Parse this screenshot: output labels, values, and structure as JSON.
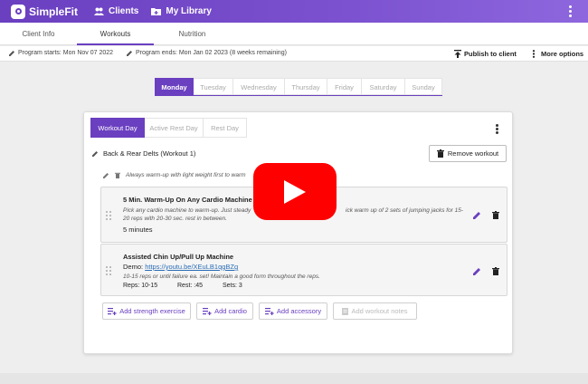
{
  "app": {
    "name": "SimpleFit"
  },
  "topnav": {
    "clients": "Clients",
    "library": "My Library"
  },
  "tabs": [
    {
      "label": "Client Info"
    },
    {
      "label": "Workouts"
    },
    {
      "label": "Nutrition"
    }
  ],
  "infobar": {
    "program_start": "Program starts: Mon Nov 07 2022",
    "program_end": "Program ends: Mon Jan 02 2023 (8 weeks remaining)",
    "publish": "Publish to client",
    "more": "More options"
  },
  "days": [
    "Monday",
    "Tuesday",
    "Wednesday",
    "Thursday",
    "Friday",
    "Saturday",
    "Sunday"
  ],
  "day_tabs": [
    "Workout Day",
    "Active Rest Day",
    "Rest Day"
  ],
  "workout": {
    "title": "Back & Rear Delts (Workout 1)",
    "remove": "Remove workout",
    "notes": "Always warm-up with light weight first to warm"
  },
  "exercises": [
    {
      "title": "5 Min. Warm-Up On Any Cardio Machine",
      "desc_1": "Pick any cardio machine to warm-up. Just steady",
      "desc_1b": "ick warm up of 2 sets of jumping jacks for 15-",
      "desc_2": "20 reps with 20-30 sec. rest in between.",
      "duration": "5 minutes"
    },
    {
      "title": "Assisted Chin Up/Pull Up Machine",
      "demo_label": "Demo:",
      "demo_link": "https://youtu.be/XEuLB1qgBZg",
      "desc": "10-15 reps or until failure ea. set! Maintain a good form throughout the reps.",
      "reps": "Reps: 10-15",
      "rest": "Rest: :45",
      "sets": "Sets: 3"
    }
  ],
  "add_buttons": {
    "strength": "Add strength exercise",
    "cardio": "Add cardio",
    "accessory": "Add accessory",
    "notes": "Add workout notes"
  },
  "colors": {
    "accent": "#6a3fc0",
    "youtube": "#ff0000"
  },
  "icons": [
    "clients-icon",
    "library-icon",
    "pencil-icon",
    "trash-icon",
    "publish-icon",
    "kebab-icon",
    "drag-handle-icon",
    "add-list-icon",
    "note-icon",
    "youtube-play-icon"
  ]
}
